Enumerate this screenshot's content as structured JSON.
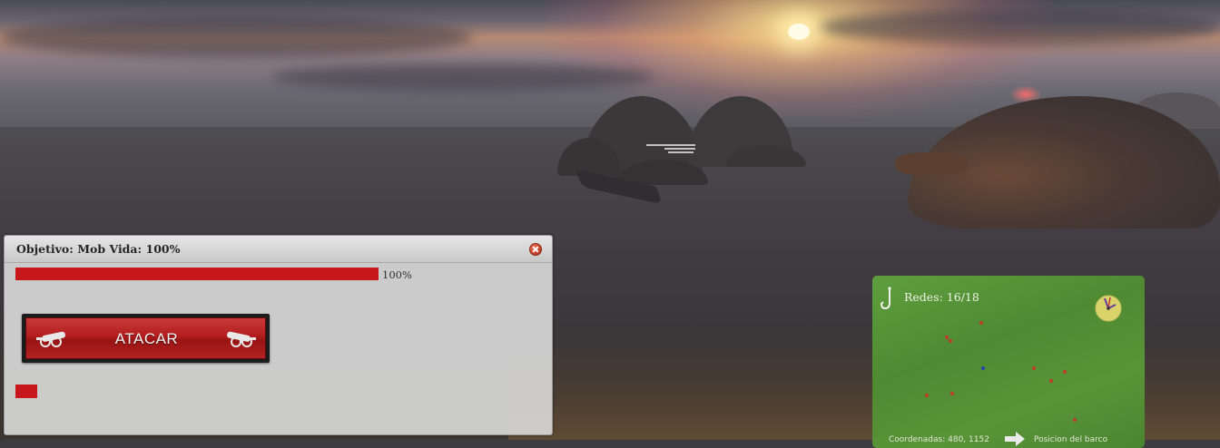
{
  "objective_window": {
    "title": "Objetivo: Mob Vida: 100%",
    "health_percent_label": "100%",
    "health_fraction": 1.0,
    "attack_button_label": "ATACAR",
    "close_icon": "close-icon",
    "colors": {
      "health": "#c8171b",
      "attack_button": "#b21c1c"
    }
  },
  "fishing_panel": {
    "nets_label": "Redes: 16/18",
    "hook_icon": "fishing-hook-icon",
    "clock_icon": "clock-icon",
    "bottom_left_text": "Coordenadas: 480, 1152",
    "bottom_right_text": "Posicion del barco",
    "colors": {
      "background": "#5a9438",
      "red_marker": "#c23b2a",
      "blue_marker": "#2b3fb3"
    }
  }
}
